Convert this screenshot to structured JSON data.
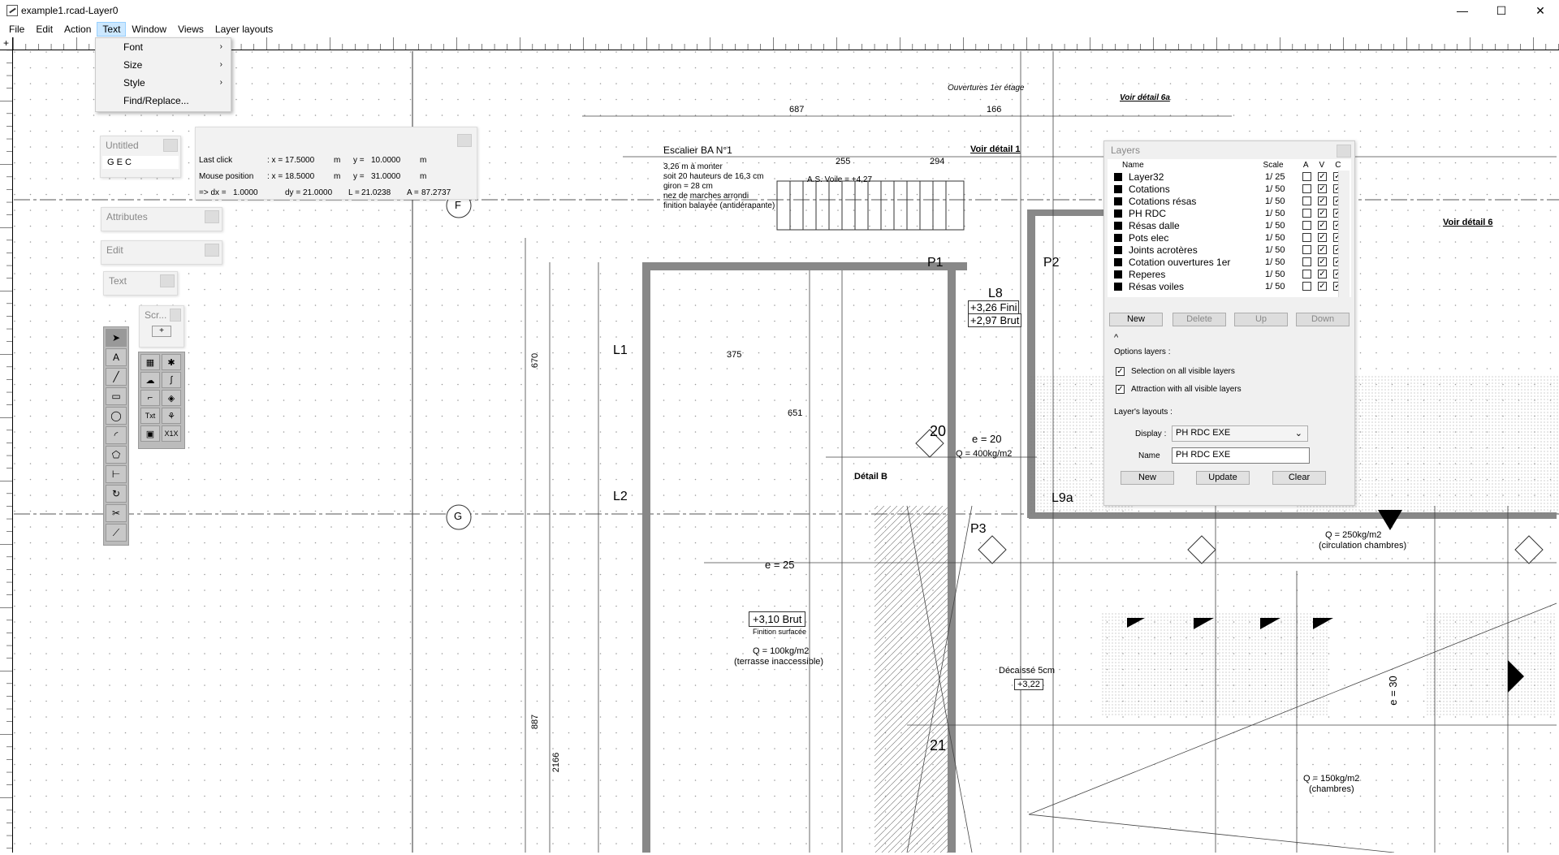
{
  "window": {
    "title": "example1.rcad-Layer0",
    "minimize": "—",
    "maximize": "☐",
    "close": "✕"
  },
  "menubar": {
    "items": [
      "File",
      "Edit",
      "Action",
      "Text",
      "Window",
      "Views",
      "Layer layouts"
    ],
    "active": "Text"
  },
  "text_menu": {
    "items": [
      "Font",
      "Size",
      "Style",
      "Find/Replace..."
    ]
  },
  "ruler": {
    "corner": "+"
  },
  "untitled_panel": {
    "title": "Untitled",
    "content": "G E C"
  },
  "attributes_panel": {
    "title": "Attributes"
  },
  "edit_panel": {
    "title": "Edit"
  },
  "text_panel": {
    "title": "Text"
  },
  "scr_panel": {
    "title": "Scr...",
    "add": "+"
  },
  "status": {
    "last_click": {
      "label": "Last click",
      "x": "17.5000",
      "y": "10.0000",
      "unit": "m"
    },
    "mouse_position": {
      "label": "Mouse position",
      "x": "18.5000",
      "y": "31.0000",
      "unit": "m"
    },
    "delta": {
      "prefix": "=> dx =",
      "dx": "1.0000",
      "dy": "21.0000",
      "L": "21.0238",
      "A": "87.2737"
    }
  },
  "layers_panel": {
    "title": "Layers",
    "headers": {
      "name": "Name",
      "scale": "Scale",
      "a": "A",
      "v": "V",
      "c": "C"
    },
    "rows": [
      {
        "name": "Layer32",
        "scale": "1/  25",
        "a": false,
        "v": true,
        "c": true
      },
      {
        "name": "Cotations",
        "scale": "1/  50",
        "a": false,
        "v": true,
        "c": true
      },
      {
        "name": "Cotations résas",
        "scale": "1/  50",
        "a": false,
        "v": true,
        "c": true
      },
      {
        "name": "PH RDC",
        "scale": "1/  50",
        "a": false,
        "v": true,
        "c": true
      },
      {
        "name": "Résas dalle",
        "scale": "1/  50",
        "a": false,
        "v": true,
        "c": true
      },
      {
        "name": "Pots elec",
        "scale": "1/  50",
        "a": false,
        "v": true,
        "c": true
      },
      {
        "name": "Joints acrotères",
        "scale": "1/  50",
        "a": false,
        "v": true,
        "c": true
      },
      {
        "name": "Cotation ouvertures 1er",
        "scale": "1/  50",
        "a": false,
        "v": true,
        "c": true
      },
      {
        "name": "Reperes",
        "scale": "1/  50",
        "a": false,
        "v": true,
        "c": true
      },
      {
        "name": "Résas voiles",
        "scale": "1/  50",
        "a": false,
        "v": true,
        "c": true
      }
    ],
    "buttons": {
      "new": "New",
      "delete": "Delete",
      "up": "Up",
      "down": "Down"
    },
    "collapse": "^",
    "options_label": "Options layers :",
    "opt_selection": "Selection on all visible layers",
    "opt_attraction": "Attraction with all visible layers",
    "layouts_label": "Layer's layouts :",
    "display_label": "Display :",
    "display_value": "PH RDC EXE",
    "name_label": "Name",
    "name_value": "PH RDC EXE",
    "layout_buttons": {
      "new": "New",
      "update": "Update",
      "clear": "Clear"
    }
  },
  "plan_labels": [
    "Escalier BA N°1",
    "3,26 m à monter",
    "soit 20 hauteurs de 16,3 cm",
    "giron = 28 cm",
    "nez de marches arrondi",
    "finition balayée (antidérapante)",
    "A.S. Voile = +4,27",
    "Voir détail 1",
    "Ouvertures 1er étage",
    "Voir détail 6a",
    "Voir détail 6",
    "L1",
    "L2",
    "L8",
    "+3,26 Fini",
    "+2,97 Brut",
    "P1",
    "P2",
    "P3",
    "L9a",
    "Q = 400kg/m2",
    "e = 20",
    "e = 25",
    "+3,10 Brut",
    "Finition surfacée",
    "Q = 100kg/m2",
    "(terrasse inaccessible)",
    "Détail B",
    "Q = 250kg/m2",
    "(circulation chambres)",
    "Q = 150kg/m2",
    "(chambres)",
    "Décaissé 5cm",
    "+3,22",
    "21",
    "20",
    "e = 30",
    "G",
    "F",
    "687",
    "166",
    "255",
    "294",
    "375",
    "651",
    "670",
    "887",
    "2166"
  ]
}
